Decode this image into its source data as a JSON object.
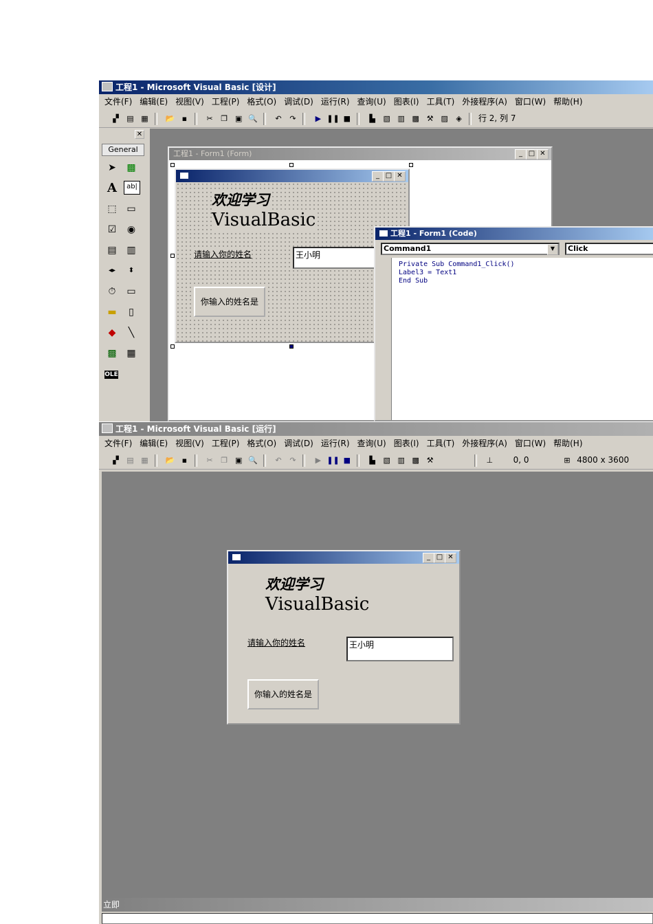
{
  "design": {
    "title": "工程1 - Microsoft Visual Basic [设计]",
    "menu": [
      "文件(F)",
      "编辑(E)",
      "视图(V)",
      "工程(P)",
      "格式(O)",
      "调试(D)",
      "运行(R)",
      "查询(U)",
      "图表(I)",
      "工具(T)",
      "外接程序(A)",
      "窗口(W)",
      "帮助(H)"
    ],
    "status": "行 2, 列 7",
    "toolbox_tab": "General",
    "form_window_title": "工程1 - Form1 (Form)",
    "form": {
      "line1": "欢迎学习",
      "line2": "VisualBasic",
      "prompt": "请输入你的姓名",
      "textbox": "王小明",
      "button": "你输入的姓名是"
    },
    "code_window": {
      "title": "工程1 - Form1 (Code)",
      "object": "Command1",
      "procedure": "Click",
      "lines": [
        "Private Sub Command1_Click()",
        "Label3 = Text1",
        "End Sub"
      ]
    }
  },
  "run": {
    "title": "工程1 - Microsoft Visual Basic [运行]",
    "menu": [
      "文件(F)",
      "编辑(E)",
      "视图(V)",
      "工程(P)",
      "格式(O)",
      "调试(D)",
      "运行(R)",
      "查询(U)",
      "图表(I)",
      "工具(T)",
      "外接程序(A)",
      "窗口(W)",
      "帮助(H)"
    ],
    "position": "0, 0",
    "size": "4800 x 3600",
    "form": {
      "line1": "欢迎学习",
      "line2": "VisualBasic",
      "prompt": "请输入你的姓名",
      "textbox": "王小明",
      "button": "你输入的姓名是"
    },
    "immediate_label": "立即"
  }
}
